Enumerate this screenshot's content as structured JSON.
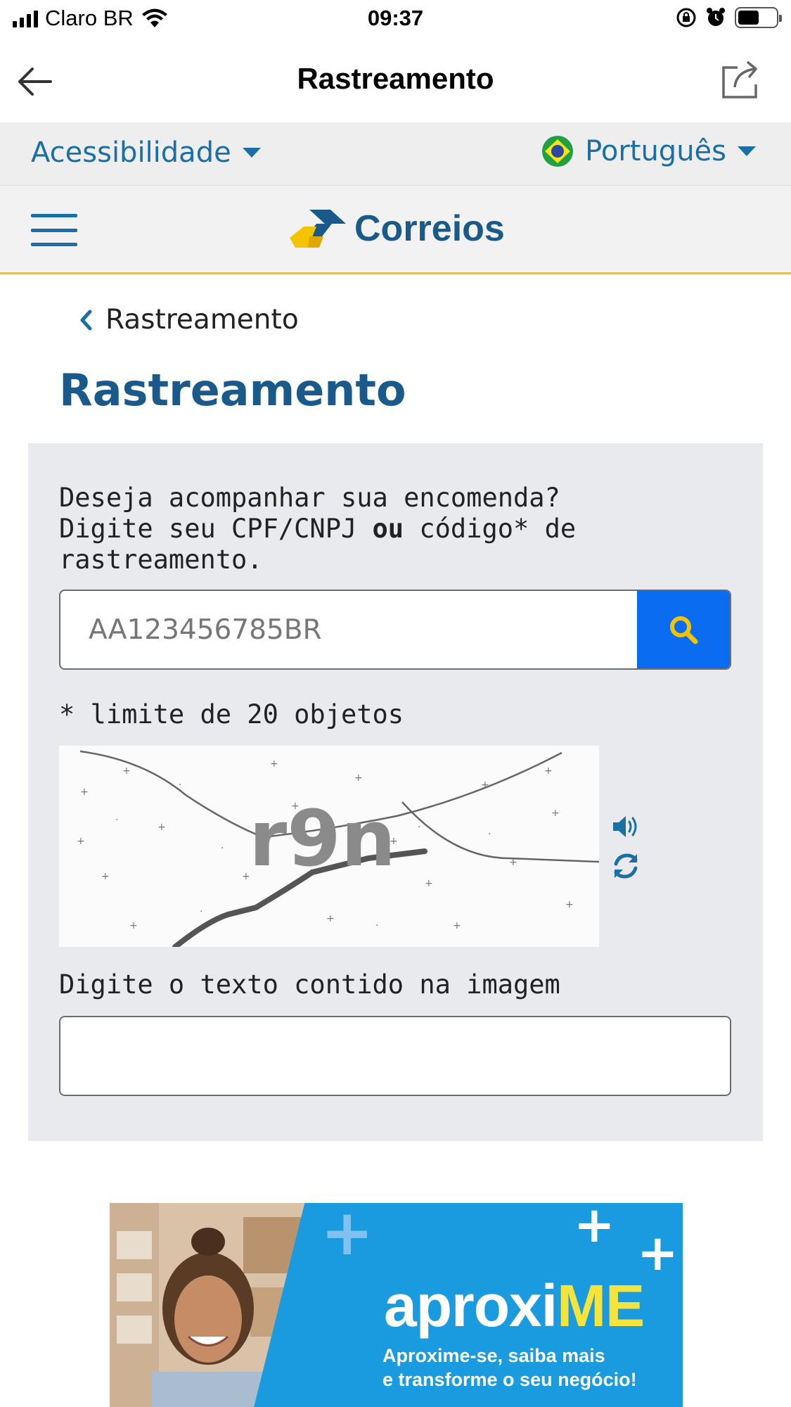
{
  "status_bar": {
    "carrier": "Claro BR",
    "time": "09:37"
  },
  "nav": {
    "title": "Rastreamento"
  },
  "lang_bar": {
    "accessibility_label": "Acessibilidade",
    "language_label": "Português"
  },
  "brand": {
    "logo_text": "Correios"
  },
  "breadcrumb": {
    "label": "Rastreamento"
  },
  "page": {
    "title": "Rastreamento"
  },
  "tracking": {
    "instruction_line1": "Deseja acompanhar sua encomenda?",
    "instruction_line2_a": "Digite seu CPF/CNPJ ",
    "instruction_line2_bold": "ou",
    "instruction_line2_b": " código* de",
    "instruction_line3": "rastreamento.",
    "placeholder": "AA123456785BR",
    "value": "",
    "limit_note": "* limite de 20 objetos"
  },
  "captcha": {
    "text": "r9n",
    "label": "Digite o texto contido na imagem",
    "value": ""
  },
  "banner": {
    "title_main": "aproxi",
    "title_accent": "ME",
    "subtitle_line1": "Aproxime-se, saiba mais",
    "subtitle_line2": "e transforme o seu negócio!"
  },
  "colors": {
    "brand_blue": "#1a5a8a",
    "link_blue": "#1a6fa6",
    "search_button": "#0a6cf0",
    "search_icon": "#f4c400",
    "brand_yellow": "#f4c400",
    "panel_bg": "#e9eaed"
  },
  "icons": {
    "back": "arrow-left-icon",
    "share": "share-icon",
    "menu": "hamburger-icon",
    "search": "search-icon",
    "audio": "speaker-icon",
    "refresh": "refresh-icon",
    "flag": "brazil-flag-icon"
  }
}
